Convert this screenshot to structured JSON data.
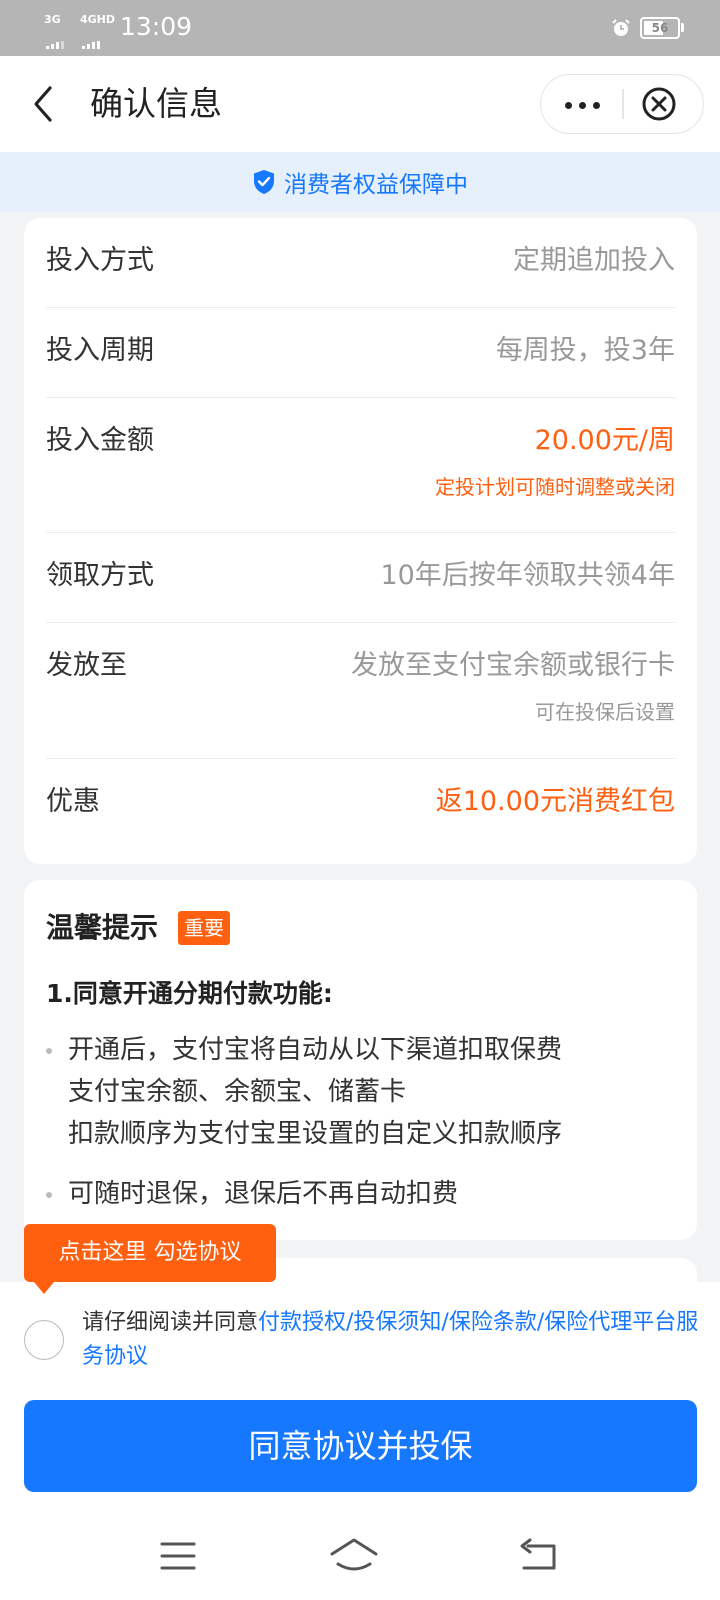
{
  "status_bar": {
    "network1": "3G",
    "network2": "4GHD",
    "time": "13:09",
    "battery": "56",
    "battery_level_percent": 56
  },
  "nav": {
    "title": "确认信息",
    "back_icon": "chevron-left-icon",
    "more_icon": "more-dots-icon",
    "close_icon": "close-circle-icon"
  },
  "guarantee": {
    "text": "消费者权益保障中",
    "icon": "shield-check-icon"
  },
  "info": {
    "rows": [
      {
        "label": "投入方式",
        "value": "定期追加投入"
      },
      {
        "label": "投入周期",
        "value": "每周投，投3年"
      },
      {
        "label": "投入金额",
        "value": "20.00元/周",
        "sub": "定投计划可随时调整或关闭"
      },
      {
        "label": "领取方式",
        "value": "10年后按年领取共领4年"
      },
      {
        "label": "发放至",
        "value": "发放至支付宝余额或银行卡",
        "sub": "可在投保后设置"
      },
      {
        "label": "优惠",
        "value": "返10.00元消费红包"
      }
    ]
  },
  "tips": {
    "title": "温馨提示",
    "badge": "重要",
    "subtitle": "1.同意开通分期付款功能:",
    "bullet1": [
      "开通后，支付宝将自动从以下渠道扣取保费",
      "支付宝余额、余额宝、储蓄卡",
      "扣款顺序为支付宝里设置的自定义扣款顺序"
    ],
    "bullet2": "可随时退保，退保后不再自动扣费"
  },
  "tooltip": {
    "text": "点击这里 勾选协议"
  },
  "agreement": {
    "prefix": "请仔细阅读并同意",
    "links": "付款授权/投保须知/保险条款/保险代理平台服务协议"
  },
  "confirm_button": "同意协议并投保",
  "colors": {
    "brand_blue": "#1677ff",
    "accent_orange": "#ff6010",
    "status_bar": "#b5b5b5"
  }
}
